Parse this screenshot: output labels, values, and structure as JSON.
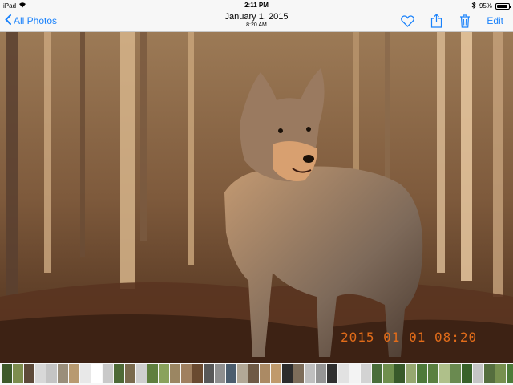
{
  "status_bar": {
    "device": "iPad",
    "time": "2:11 PM",
    "battery": "95%",
    "battery_level": 0.95,
    "icons": [
      "wifi-icon",
      "bluetooth-icon",
      "battery-icon"
    ]
  },
  "nav": {
    "back_label": "All Photos",
    "title": "January 1, 2015",
    "subtitle": "8:20 AM",
    "edit_label": "Edit",
    "actions": [
      "heart-icon",
      "share-icon",
      "trash-icon"
    ],
    "accent_color": "#1a82fb"
  },
  "photo": {
    "timestamp_overlay": "2015 01 01  08:20",
    "timestamp_color": "#e26c1a"
  },
  "filmstrip": {
    "thumb_colors": [
      "#3e5a2a",
      "#7d8d4e",
      "#5d4a39",
      "#d8d8d8",
      "#c4c4c4",
      "#9a8e7a",
      "#b89a70",
      "#e8e8e8",
      "#ffffff",
      "#c9c9c9",
      "#4e6a36",
      "#7a6a4d",
      "#cfcfcf",
      "#5f7f3e",
      "#8aa25c",
      "#9b8662",
      "#a08060",
      "#6a4a30",
      "#585858",
      "#8f8f8f",
      "#4b5d6e",
      "#b2a896",
      "#6f5a45",
      "#ab8a64",
      "#c09a6c",
      "#2c2c2c",
      "#7d6d5a",
      "#bfbfbf",
      "#959595",
      "#303030",
      "#e2e2e2",
      "#f3f3f3",
      "#d3d3d3",
      "#4a6e3a",
      "#6f8f4d",
      "#385a2a",
      "#96a870",
      "#4e7a3a",
      "#5a8040",
      "#afc08a",
      "#6a8a50",
      "#39622a",
      "#c5c5c5",
      "#556e3e",
      "#77904f",
      "#4c7b38",
      "#90ac68",
      "#4d7536"
    ]
  }
}
